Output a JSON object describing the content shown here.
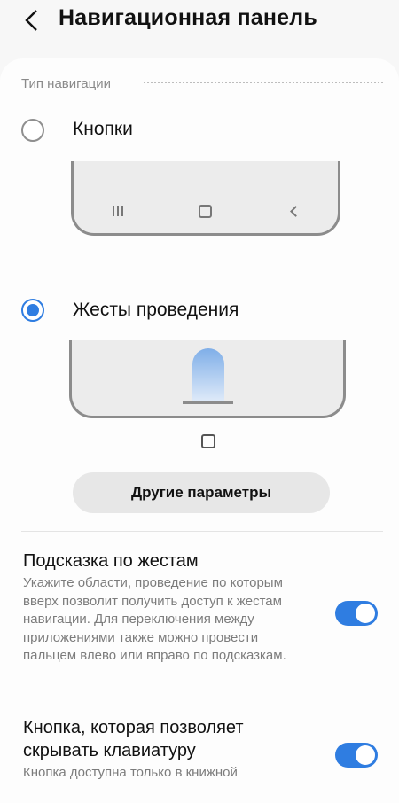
{
  "header": {
    "title": "Навигационная панель"
  },
  "section": {
    "label": "Тип навигации"
  },
  "options": [
    {
      "label": "Кнопки",
      "selected": false
    },
    {
      "label": "Жесты проведения",
      "selected": true
    }
  ],
  "other_button": {
    "label": "Другие параметры"
  },
  "settings": [
    {
      "title": "Подсказка по жестам",
      "description": "Укажите области, проведение по которым вверх позволит получить доступ к жестам навигации. Для переключения между приложениями также можно провести пальцем влево или вправо по подсказкам.",
      "enabled": true
    },
    {
      "title": "Кнопка, которая позволяет скрывать клавиатуру",
      "description": "Кнопка доступна только в книжной",
      "enabled": true
    }
  ],
  "colors": {
    "accent": "#2f7de1",
    "background": "#f7f7f7"
  }
}
